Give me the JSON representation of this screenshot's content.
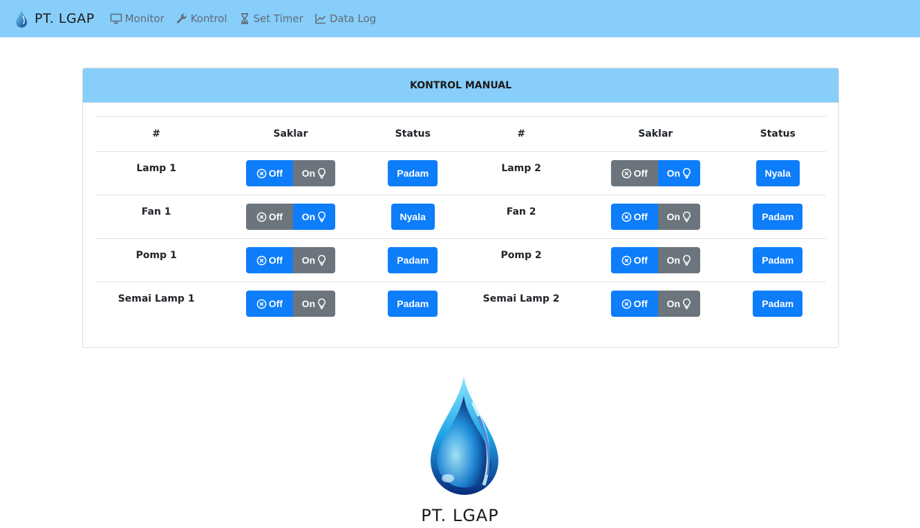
{
  "nav": {
    "brand": "PT. LGAP",
    "items": [
      {
        "label": "Monitor",
        "icon": "monitor-icon"
      },
      {
        "label": "Kontrol",
        "icon": "wrench-icon"
      },
      {
        "label": "Set Timer",
        "icon": "hourglass-icon"
      },
      {
        "label": "Data Log",
        "icon": "chart-line-icon"
      }
    ]
  },
  "card": {
    "title": "KONTROL MANUAL",
    "headers": [
      "#",
      "Saklar",
      "Status",
      "#",
      "Saklar",
      "Status"
    ],
    "switch_off_label": "Off",
    "switch_on_label": "On",
    "rows": [
      {
        "left": {
          "name": "Lamp 1",
          "state": "off",
          "status": "Padam"
        },
        "right": {
          "name": "Lamp 2",
          "state": "on",
          "status": "Nyala"
        }
      },
      {
        "left": {
          "name": "Fan 1",
          "state": "on",
          "status": "Nyala"
        },
        "right": {
          "name": "Fan 2",
          "state": "off",
          "status": "Padam"
        }
      },
      {
        "left": {
          "name": "Pomp 1",
          "state": "off",
          "status": "Padam"
        },
        "right": {
          "name": "Pomp 2",
          "state": "off",
          "status": "Padam"
        }
      },
      {
        "left": {
          "name": "Semai Lamp 1",
          "state": "off",
          "status": "Padam"
        },
        "right": {
          "name": "Semai Lamp 2",
          "state": "off",
          "status": "Padam"
        }
      }
    ]
  },
  "footer": {
    "logo_text": "PT. LGAP"
  },
  "colors": {
    "navbar": "#87cefa",
    "primary": "#0d7dfa",
    "secondary": "#6c757d"
  }
}
